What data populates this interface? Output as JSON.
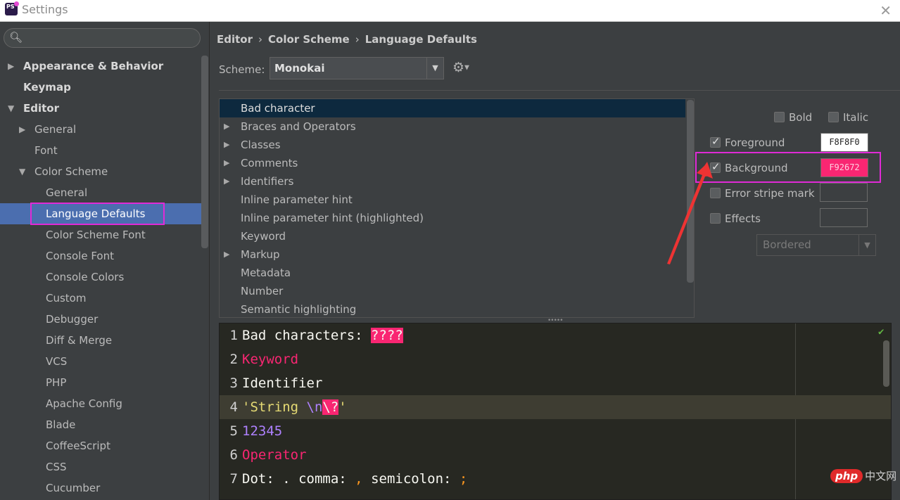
{
  "window": {
    "title": "Settings",
    "logo_text": "PS"
  },
  "sidebar": {
    "items": [
      {
        "label": "Appearance & Behavior",
        "level": 0,
        "arrow": "right",
        "bold": true
      },
      {
        "label": "Keymap",
        "level": 0,
        "arrow": "",
        "bold": true
      },
      {
        "label": "Editor",
        "level": 0,
        "arrow": "down",
        "bold": true
      },
      {
        "label": "General",
        "level": 1,
        "arrow": "right"
      },
      {
        "label": "Font",
        "level": 1,
        "arrow": ""
      },
      {
        "label": "Color Scheme",
        "level": 1,
        "arrow": "down"
      },
      {
        "label": "General",
        "level": 2,
        "arrow": ""
      },
      {
        "label": "Language Defaults",
        "level": 2,
        "arrow": "",
        "selected": true
      },
      {
        "label": "Color Scheme Font",
        "level": 2,
        "arrow": ""
      },
      {
        "label": "Console Font",
        "level": 2,
        "arrow": ""
      },
      {
        "label": "Console Colors",
        "level": 2,
        "arrow": ""
      },
      {
        "label": "Custom",
        "level": 2,
        "arrow": ""
      },
      {
        "label": "Debugger",
        "level": 2,
        "arrow": ""
      },
      {
        "label": "Diff & Merge",
        "level": 2,
        "arrow": ""
      },
      {
        "label": "VCS",
        "level": 2,
        "arrow": ""
      },
      {
        "label": "PHP",
        "level": 2,
        "arrow": ""
      },
      {
        "label": "Apache Config",
        "level": 2,
        "arrow": ""
      },
      {
        "label": "Blade",
        "level": 2,
        "arrow": ""
      },
      {
        "label": "CoffeeScript",
        "level": 2,
        "arrow": ""
      },
      {
        "label": "CSS",
        "level": 2,
        "arrow": ""
      },
      {
        "label": "Cucumber",
        "level": 2,
        "arrow": ""
      }
    ]
  },
  "breadcrumb": {
    "part1": "Editor",
    "part2": "Color Scheme",
    "part3": "Language Defaults",
    "sep": "›"
  },
  "scheme": {
    "label": "Scheme:",
    "value": "Monokai"
  },
  "attributes": [
    {
      "label": "Bad character",
      "arrow": false,
      "selected": true
    },
    {
      "label": "Braces and Operators",
      "arrow": true
    },
    {
      "label": "Classes",
      "arrow": true
    },
    {
      "label": "Comments",
      "arrow": true
    },
    {
      "label": "Identifiers",
      "arrow": true
    },
    {
      "label": "Inline parameter hint",
      "arrow": false
    },
    {
      "label": "Inline parameter hint (highlighted)",
      "arrow": false
    },
    {
      "label": "Keyword",
      "arrow": false
    },
    {
      "label": "Markup",
      "arrow": true
    },
    {
      "label": "Metadata",
      "arrow": false
    },
    {
      "label": "Number",
      "arrow": false
    },
    {
      "label": "Semantic highlighting",
      "arrow": false
    }
  ],
  "props": {
    "bold_label": "Bold",
    "italic_label": "Italic",
    "foreground_label": "Foreground",
    "foreground_value": "F8F8F0",
    "foreground_color": "#ffffff",
    "background_label": "Background",
    "background_value": "F92672",
    "background_color": "#f92672",
    "error_stripe_label": "Error stripe mark",
    "effects_label": "Effects",
    "effects_type": "Bordered"
  },
  "preview": {
    "line1_text": "Bad characters: ",
    "line1_bad": "????",
    "line2_kw": "Keyword",
    "line3_text": "Identifier",
    "line4_str1": "'String ",
    "line4_esc": "\\n",
    "line4_bad": "\\?",
    "line4_str2": "'",
    "line5_num": "12345",
    "line6_op": "Operator",
    "line7_a": "Dot: ",
    "line7_dot": ".",
    "line7_b": " comma: ",
    "line7_comma": ",",
    "line7_c": " semicolon: ",
    "line7_semi": ";"
  },
  "watermark": {
    "php": "php",
    "cn": "中文网"
  },
  "colors": {
    "accent_highlight": "#e02ad6",
    "selection": "#4b6eaf",
    "editor_bg": "#272822"
  }
}
